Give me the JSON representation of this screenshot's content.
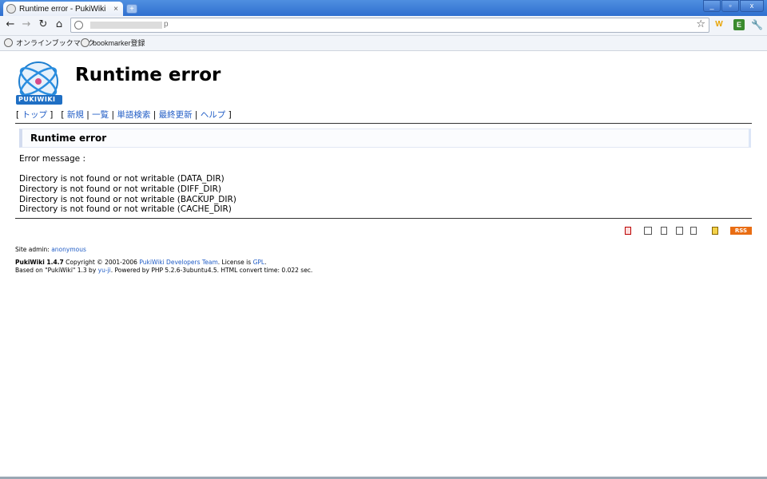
{
  "browser": {
    "tab_title": "Runtime error - PukiWiki",
    "tab_close": "×",
    "new_tab": "+",
    "window_controls": {
      "minimize": "_",
      "maximize": "▫",
      "close": "x"
    },
    "url": "p",
    "icons": [
      "back-arrow-icon",
      "forward-arrow-icon",
      "reload-icon",
      "home-icon",
      "star-icon",
      "wrench-icon"
    ],
    "extensions": {
      "w": "W",
      "evernote": "E",
      "wrench": "🔧"
    },
    "bookmarks": [
      {
        "label": "オンラインブックマーク"
      },
      {
        "label": "bookmarker登録"
      }
    ]
  },
  "page": {
    "logo_text": "PUKIWIKI",
    "title": "Runtime error",
    "nav": {
      "open": "[",
      "top": "トップ",
      "close": "]",
      "open2": "[",
      "items": [
        "新規",
        "一覧",
        "単語検索",
        "最終更新",
        "ヘルプ"
      ],
      "sep": "|",
      "close2": "]"
    },
    "error_heading": "Runtime error",
    "error_label": "Error message :",
    "errors": [
      "Directory is not found or not writable (DATA_DIR)",
      "Directory is not found or not writable (DIFF_DIR)",
      "Directory is not found or not writable (BACKUP_DIR)",
      "Directory is not found or not writable (CACHE_DIR)"
    ],
    "rss_label": "RSS"
  },
  "footer": {
    "admin_prefix": "Site admin: ",
    "admin_name": "anonymous",
    "product": "PukiWiki 1.4.7",
    "copyright_prefix": " Copyright © 2001-2006 ",
    "dev_team": "PukiWiki Developers Team",
    "license_prefix": ". License is ",
    "license": "GPL",
    "license_suffix": ".",
    "based_prefix": "Based on \"PukiWiki\" 1.3 by ",
    "author": "yu-ji",
    "based_suffix": ". Powered by PHP 5.2.6-3ubuntu4.5. HTML convert time: 0.022 sec."
  },
  "colors": {
    "link": "#215dc6",
    "rss": "#e96d13",
    "chrome": "#2f6fcf"
  }
}
